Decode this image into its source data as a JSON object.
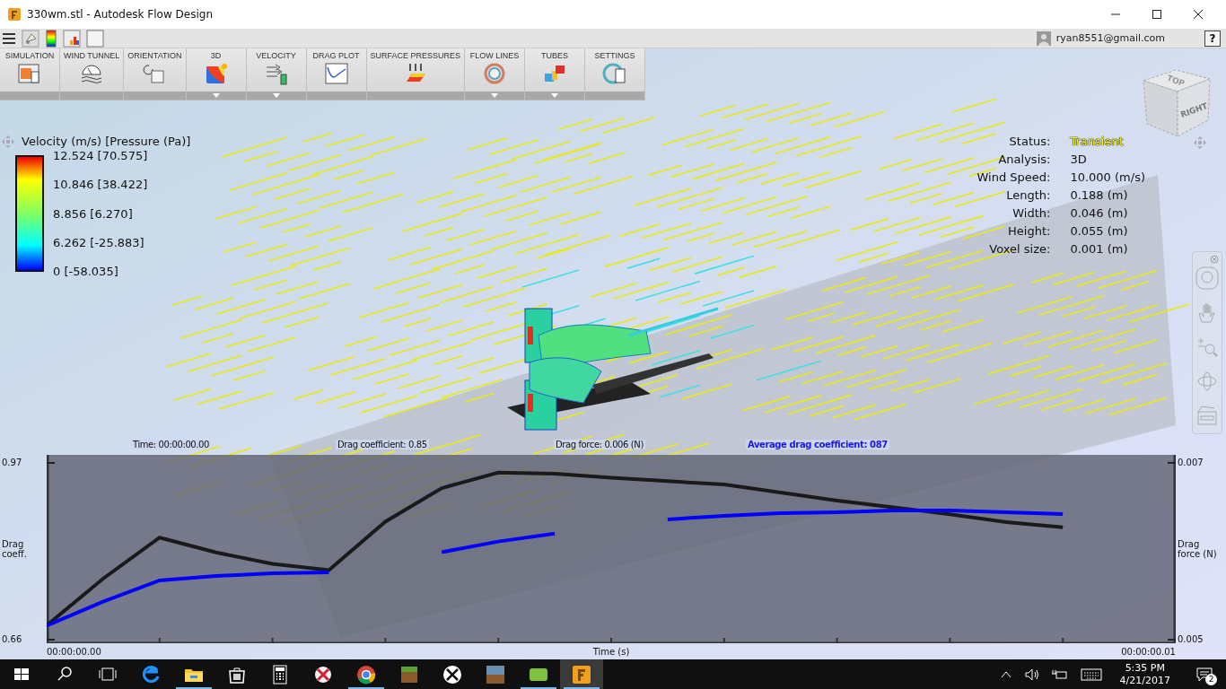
{
  "window": {
    "title": "330wm.stl - Autodesk Flow Design"
  },
  "account": {
    "email": "ryan8551@gmail.com",
    "help": "?"
  },
  "ribbon": [
    {
      "label": "SIMULATION",
      "has_menu": false
    },
    {
      "label": "WIND TUNNEL",
      "has_menu": false
    },
    {
      "label": "ORIENTATION",
      "has_menu": false
    },
    {
      "label": "3D",
      "has_menu": true
    },
    {
      "label": "VELOCITY",
      "has_menu": true
    },
    {
      "label": "DRAG PLOT",
      "has_menu": false
    },
    {
      "label": "SURFACE PRESSURES",
      "has_menu": false
    },
    {
      "label": "FLOW LINES",
      "has_menu": true
    },
    {
      "label": "TUBES",
      "has_menu": true
    },
    {
      "label": "SETTINGS",
      "has_menu": false
    }
  ],
  "legend": {
    "title": "Velocity (m/s) [Pressure (Pa)]",
    "labels": [
      "12.524 [70.575]",
      "10.846 [38.422]",
      "8.856 [6.270]",
      "6.262 [-25.883]",
      "0 [-58.035]"
    ]
  },
  "status": [
    {
      "label": "Status:",
      "value": "Transient",
      "highlighted": true
    },
    {
      "label": "Analysis:",
      "value": "3D",
      "highlighted": false
    },
    {
      "label": "Wind Speed:",
      "value": "10.000 (m/s)",
      "highlighted": false
    },
    {
      "label": "Length:",
      "value": "0.188 (m)",
      "highlighted": false
    },
    {
      "label": "Width:",
      "value": "0.046 (m)",
      "highlighted": false
    },
    {
      "label": "Height:",
      "value": "0.055 (m)",
      "highlighted": false
    },
    {
      "label": "Voxel size:",
      "value": "0.001 (m)",
      "highlighted": false
    }
  ],
  "view_cube": {
    "top": "TOP",
    "side": "RIGHT"
  },
  "readouts": {
    "time": "Time: 00:00:00.00",
    "drag_coefficient": "Drag coefficient: 0.85",
    "drag_force": "Drag force: 0.006 (N)",
    "average": "Average drag coefficient: 087"
  },
  "drag_plot": {
    "chart_data": {
      "type": "line",
      "xlabel": "Time (s)",
      "ylabel": "Drag coeff.",
      "y2label": "Drag force (N)",
      "ylim": [
        0.66,
        0.97
      ],
      "y2lim": [
        0.00496,
        0.00709
      ],
      "yticks": [
        0.66,
        0.97
      ],
      "y2ticks": [
        0.005,
        0.007
      ],
      "categories": [
        null,
        null,
        null,
        null,
        null,
        null,
        null,
        null,
        null,
        null,
        null,
        null,
        null,
        null,
        null,
        null,
        null,
        null,
        null
      ],
      "series": [
        {
          "color": "#1a1a1a",
          "axis": "y",
          "values": [
            0.685,
            0.767,
            0.839,
            0.813,
            0.793,
            0.782,
            0.867,
            0.926,
            0.953,
            0.951,
            0.944,
            0.938,
            0.932,
            0.918,
            0.904,
            0.892,
            0.88,
            0.866,
            0.857
          ]
        },
        {
          "color": "#0000ff",
          "axis": "y2",
          "values": [
            0.00516,
            0.00543,
            0.00567,
            0.00572,
            0.00575,
            0.00576,
            null,
            0.00599,
            0.00611,
            0.0062,
            null,
            0.00636,
            0.0064,
            0.00643,
            0.00644,
            0.00646,
            0.00646,
            0.00644,
            0.00642
          ]
        }
      ]
    },
    "time_start": "00:00:00.00",
    "time_end": "00:00:00.01"
  },
  "taskbar": {
    "apps": [
      {
        "kind": "edge",
        "running": false,
        "selected": false
      },
      {
        "kind": "folder",
        "running": true,
        "selected": false
      },
      {
        "kind": "store",
        "running": false,
        "selected": false
      },
      {
        "kind": "calculator",
        "running": false,
        "selected": false
      },
      {
        "kind": "disc",
        "running": false,
        "selected": false
      },
      {
        "kind": "chrome",
        "running": true,
        "selected": false
      },
      {
        "kind": "block",
        "running": false,
        "selected": false
      },
      {
        "kind": "xbox",
        "running": false,
        "selected": false
      },
      {
        "kind": "game",
        "running": false,
        "selected": false
      },
      {
        "kind": "cura",
        "running": true,
        "selected": false
      },
      {
        "kind": "flow",
        "running": true,
        "selected": true
      }
    ],
    "time": "5:35 PM",
    "date": "4/21/2017",
    "notifications": "2"
  }
}
